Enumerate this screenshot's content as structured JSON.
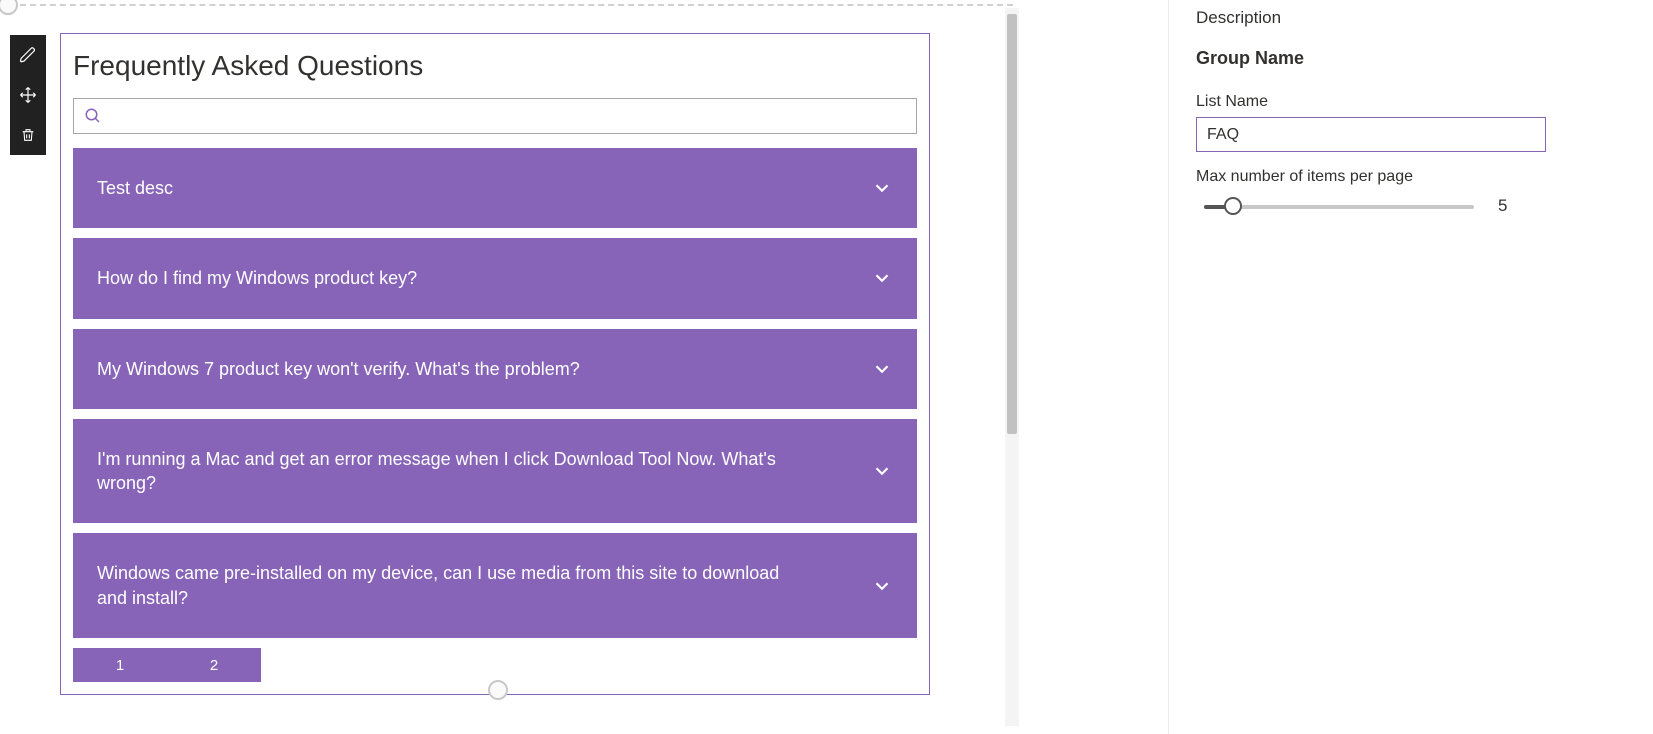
{
  "toolbar": {
    "edit": "edit-icon",
    "move": "move-icon",
    "delete": "delete-icon"
  },
  "webpart": {
    "title": "Frequently Asked Questions",
    "search_placeholder": "",
    "items": [
      {
        "question": "Test desc"
      },
      {
        "question": "How do I find my Windows product key?"
      },
      {
        "question": "My Windows 7 product key won't verify. What's the problem?"
      },
      {
        "question": "I'm running a Mac and get an error message when I click Download Tool Now. What's wrong?"
      },
      {
        "question": "Windows came pre-installed on my device, can I use media from this site to download and install?"
      }
    ],
    "pages": [
      "1",
      "2"
    ]
  },
  "pane": {
    "description_label": "Description",
    "group_heading": "Group Name",
    "list_name_label": "List Name",
    "list_name_value": "FAQ",
    "max_items_label": "Max number of items per page",
    "max_items_value": "5"
  }
}
